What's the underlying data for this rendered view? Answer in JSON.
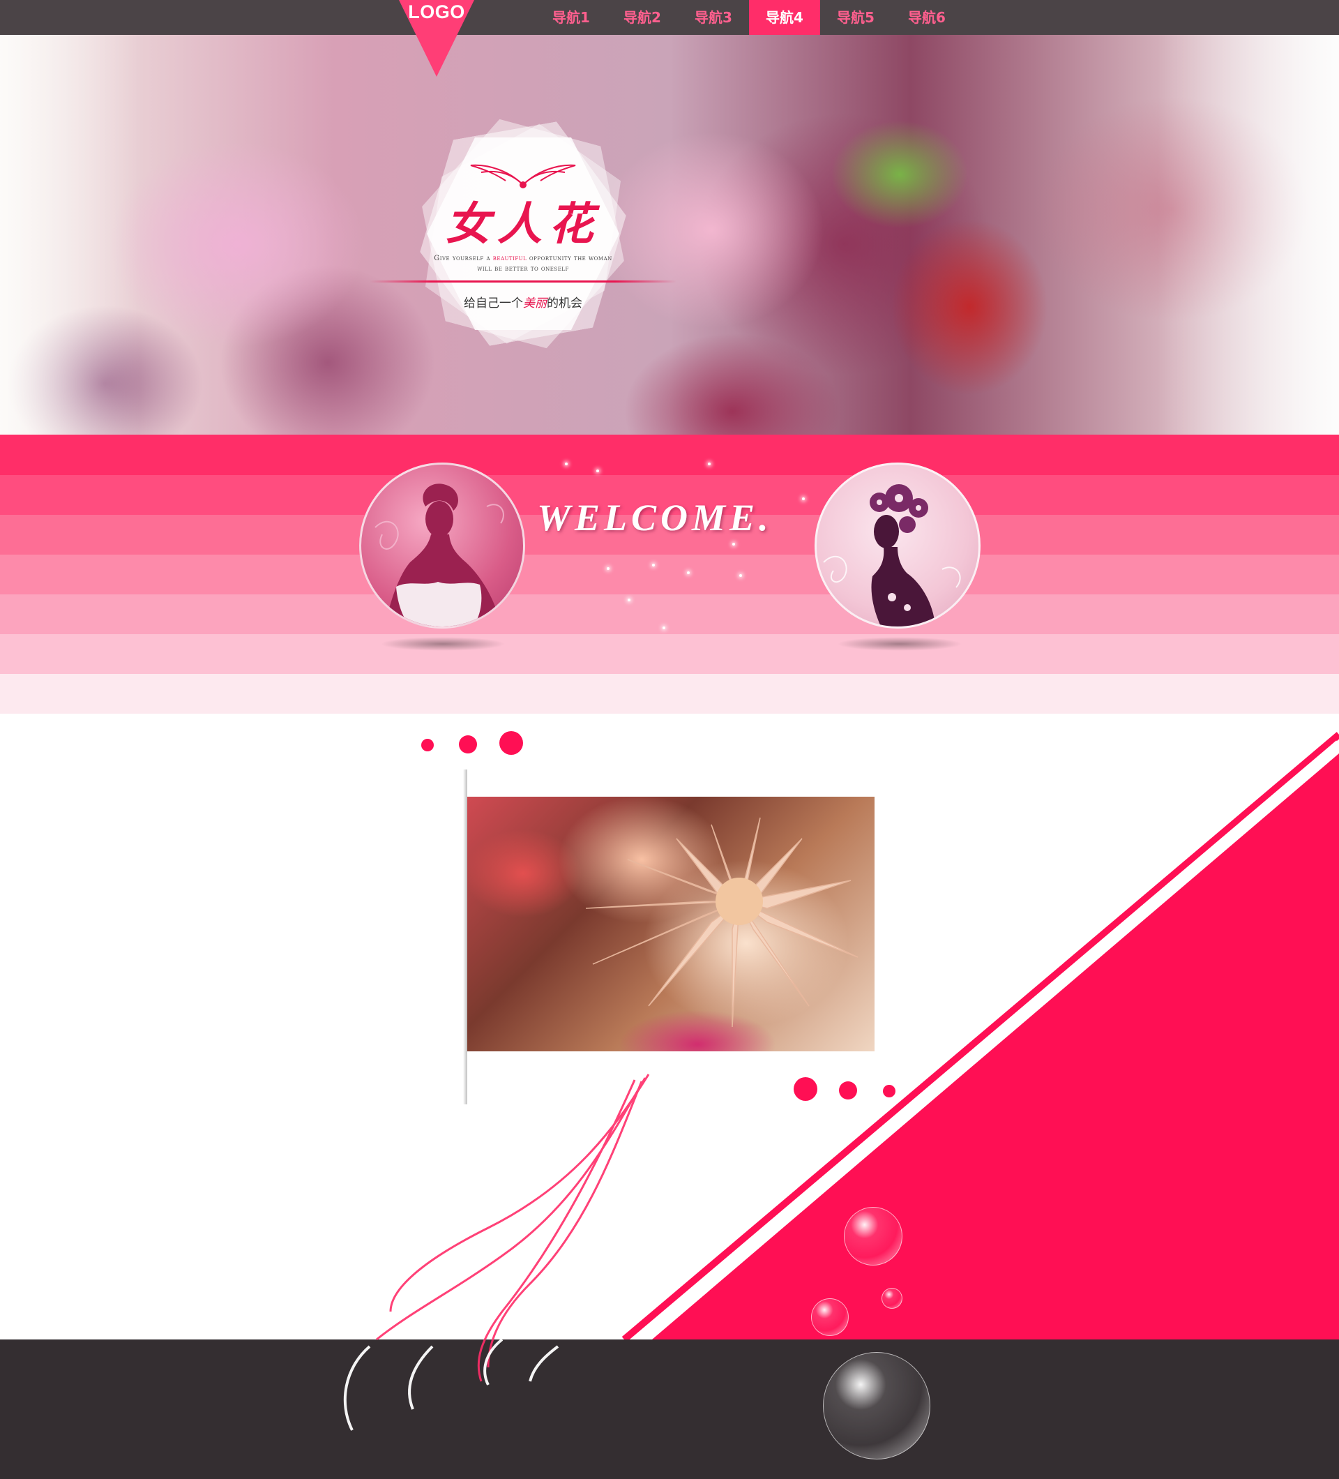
{
  "nav": {
    "logo": "LOGO",
    "items": [
      {
        "label": "导航1",
        "active": false
      },
      {
        "label": "导航2",
        "active": false
      },
      {
        "label": "导航3",
        "active": false
      },
      {
        "label": "导航4",
        "active": true
      },
      {
        "label": "导航5",
        "active": false
      },
      {
        "label": "导航6",
        "active": false
      }
    ]
  },
  "hero": {
    "title": "女人花",
    "tagline_before": "Give yourself a ",
    "tagline_highlight": "beautiful",
    "tagline_after": " opportunity the woman",
    "tagline_line2": "will be better to oneself",
    "slogan_before": "给自己一个",
    "slogan_highlight": "美丽",
    "slogan_after": "的机会"
  },
  "welcome": {
    "text": "WELCOME."
  },
  "colors": {
    "accent": "#ff0f54",
    "nav_active": "#ff2d69",
    "nav_bg": "#3c3437",
    "footer_bg": "#342e31"
  },
  "icons": {
    "logo": "downward-triangle-logo-badge",
    "wings": "wings-ornament-icon",
    "left_circle": "woman-silhouette-bride-image",
    "right_circle": "woman-silhouette-flowers-image"
  }
}
